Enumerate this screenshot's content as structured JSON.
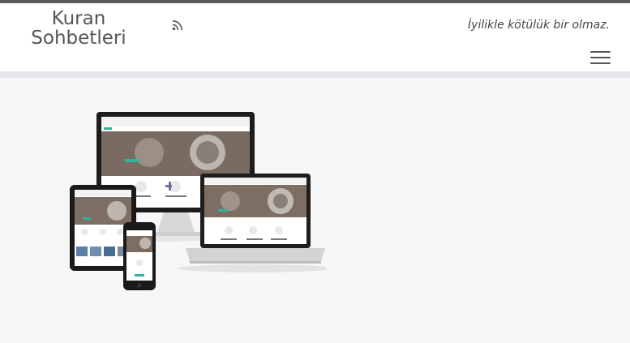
{
  "site": {
    "title_line1": "Kuran",
    "title_line2": "Sohbetleri",
    "tagline": "İyilikle kötülük bir olmaz."
  },
  "icons": {
    "rss": "rss-icon",
    "menu": "hamburger-menu-icon"
  },
  "colors": {
    "topbar": "#5a5a5a",
    "header_bg": "#ffffff",
    "divider": "#e4e4ea",
    "page_bg": "#f7f7f7",
    "accent": "#2fb59b"
  }
}
